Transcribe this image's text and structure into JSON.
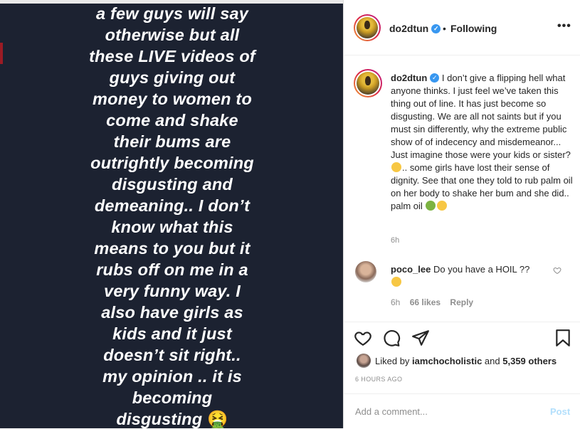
{
  "story": {
    "lines": [
      "a few guys will say",
      "otherwise but all",
      "these LIVE videos of",
      "guys giving out",
      "money to women to",
      "come and shake",
      "their bums are",
      "outrightly becoming",
      "disgusting and",
      "demeaning.. I don’t",
      "know what this",
      "means to you but it",
      "rubs off on me in a",
      "very funny way. I",
      "also have girls as",
      "kids and it just",
      "doesn’t sit right..",
      "my opinion .. it is",
      "becoming",
      "disgusting"
    ],
    "emoji": "🤮"
  },
  "header": {
    "username": "do2dtun",
    "dot": "•",
    "following": "Following",
    "more": "•••"
  },
  "caption": {
    "username": "do2dtun",
    "text_1": "I don’t give a flipping hell what anyone thinks. I just feel we’ve taken this thing out of line. It has just become so disgusting. We are all not saints but if you must sin differently, why the extreme public show of of indecency and misdemeanor... Just imagine those were your kids or sister?",
    "text_2": ".. some girls have lost their sense of dignity. See that one they told to rub palm oil on her body to shake her bum and she did.. palm oil",
    "time": "6h"
  },
  "comment": {
    "username": "poco_lee",
    "text": "Do you have a HOIL ??",
    "time": "6h",
    "likes": "66 likes",
    "reply": "Reply"
  },
  "likes": {
    "prefix": "Liked by",
    "user": "iamchocholistic",
    "joiner": "and",
    "others": "5,359 others"
  },
  "time_ago": "6 HOURS AGO",
  "add_comment": {
    "placeholder": "Add a comment...",
    "post": "Post"
  },
  "colors": {
    "story_bg": "#1c2231",
    "verified": "#3897f0",
    "post_disabled": "#b2dffc",
    "muted": "#8e8e8e"
  }
}
